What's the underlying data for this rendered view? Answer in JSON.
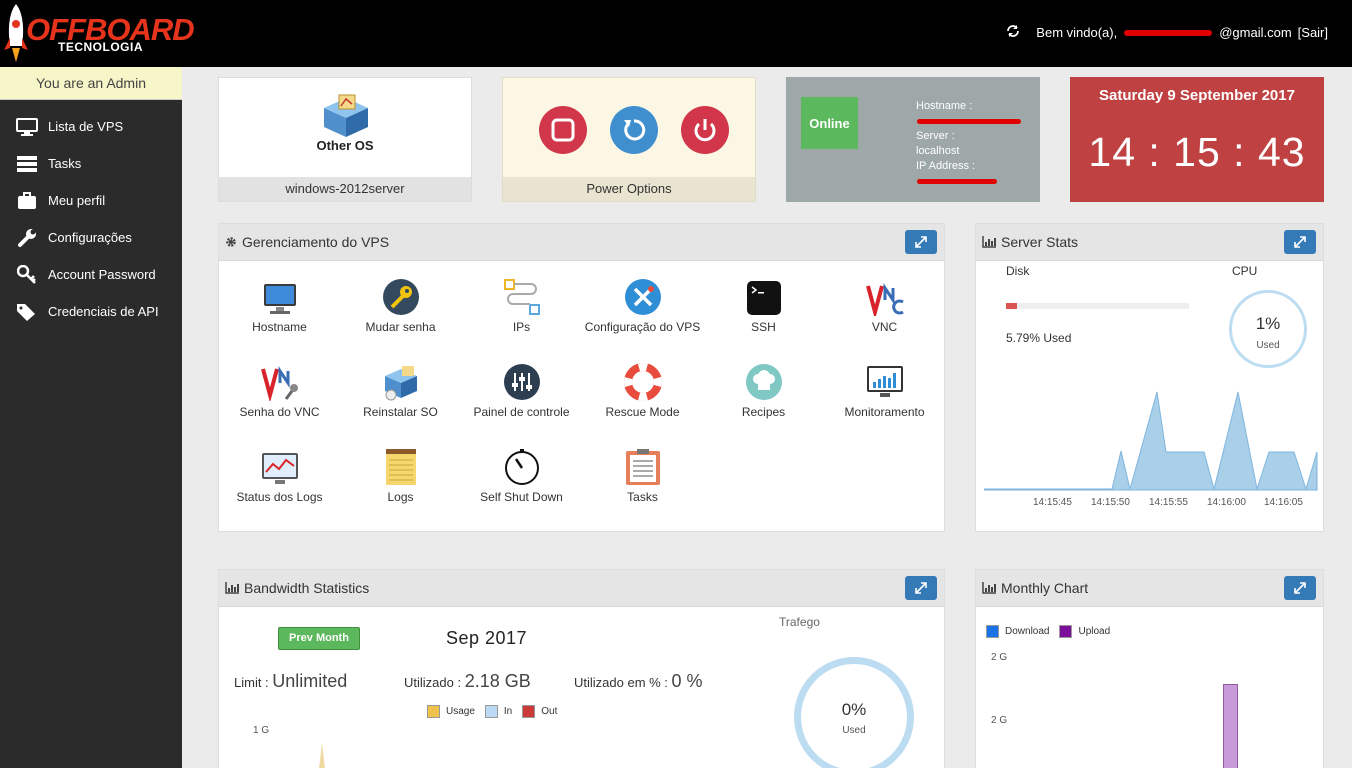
{
  "brand": {
    "name": "OFFBOARD",
    "sub": "TECNOLOGIA"
  },
  "header": {
    "welcome": "Bem vindo(a),",
    "email_suffix": "@gmail.com",
    "logout": "[Sair]"
  },
  "sidebar": {
    "role": "You are an Admin",
    "items": [
      {
        "label": "Lista de VPS",
        "icon": "monitor-icon"
      },
      {
        "label": "Tasks",
        "icon": "list-icon"
      },
      {
        "label": "Meu perfil",
        "icon": "briefcase-icon"
      },
      {
        "label": "Configurações",
        "icon": "wrench-icon"
      },
      {
        "label": "Account Password",
        "icon": "key-icon"
      },
      {
        "label": "Credenciais de API",
        "icon": "tags-icon"
      }
    ]
  },
  "os_card": {
    "title": "Other OS",
    "name": "windows-2012server"
  },
  "power_card": {
    "label": "Power Options"
  },
  "status_card": {
    "status": "Online",
    "hostname_label": "Hostname :",
    "server_label": "Server :",
    "server_value": "localhost",
    "ip_label": "IP Address :"
  },
  "clock": {
    "date": "Saturday 9 September 2017",
    "time": "14 : 15 : 43"
  },
  "vps_panel": {
    "title": "Gerenciamento do VPS",
    "tools": [
      "Hostname",
      "Mudar senha",
      "IPs",
      "Configuração do VPS",
      "SSH",
      "VNC",
      "Senha do VNC",
      "Reinstalar SO",
      "Painel de controle",
      "Rescue Mode",
      "Recipes",
      "Monitoramento",
      "Status dos Logs",
      "Logs",
      "Self Shut Down",
      "Tasks"
    ]
  },
  "stats_panel": {
    "title": "Server Stats",
    "disk_label": "Disk",
    "disk_used_text": "5.79% Used",
    "disk_used_fraction": 0.0579,
    "cpu_label": "CPU",
    "cpu_value": "1%",
    "cpu_sub": "Used",
    "times": [
      "14:15:45",
      "14:15:50",
      "14:15:55",
      "14:16:00",
      "14:16:05"
    ]
  },
  "bandwidth_panel": {
    "title": "Bandwidth Statistics",
    "prev_button": "Prev Month",
    "month": "Sep 2017",
    "limit_label": "Limit :",
    "limit_value": "Unlimited",
    "used_label": "Utilizado :",
    "used_value": "2.18 GB",
    "used_pct_label": "Utilizado em % :",
    "used_pct_value": "0 %",
    "traffic_label": "Trafego",
    "gauge_value": "0%",
    "gauge_sub": "Used",
    "legend": [
      "Usage",
      "In",
      "Out"
    ],
    "y_tick": "1 G"
  },
  "monthly_panel": {
    "title": "Monthly Chart",
    "legend": [
      "Download",
      "Upload"
    ],
    "y_ticks": [
      "2 G",
      "2 G"
    ]
  },
  "colors": {
    "accent_blue": "#337ab7",
    "online_green": "#5cb85c",
    "clock_red": "#bf4142",
    "chart_fill": "#a9cfe9"
  }
}
